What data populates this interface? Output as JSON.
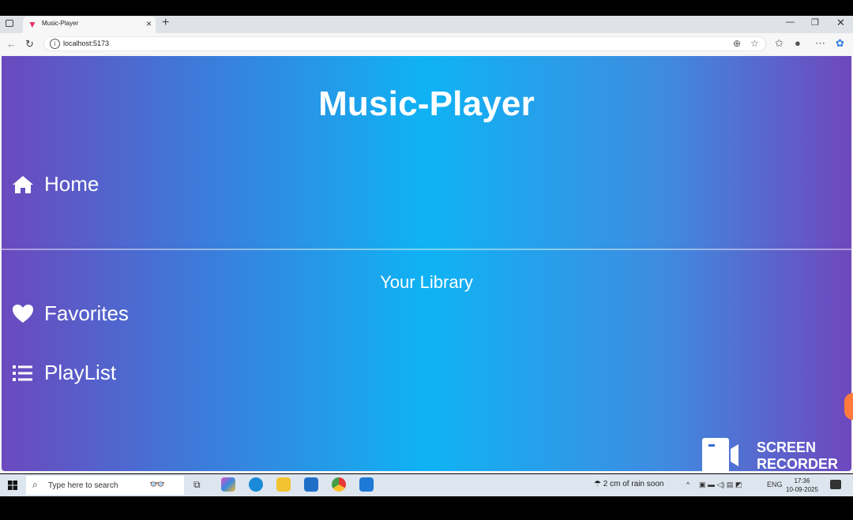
{
  "browser": {
    "tab_title": "Music-Player",
    "url": "localhost:5173"
  },
  "app": {
    "title": "Music-Player",
    "nav": [
      {
        "label": "Home",
        "icon": "home-icon"
      },
      {
        "label": "Favorites",
        "icon": "heart-icon"
      },
      {
        "label": "PlayList",
        "icon": "list-icon"
      }
    ],
    "library_heading": "Your Library"
  },
  "overlay": {
    "recorder_line1": "SCREEN",
    "recorder_line2": "RECORDER"
  },
  "taskbar": {
    "search_placeholder": "Type here to search",
    "weather": "2 cm of rain soon",
    "language": "ENG",
    "time": "17:36",
    "date": "10-09-2025"
  },
  "colors": {
    "gradient_edge": "#6b49be",
    "gradient_center": "#0fb3f4"
  }
}
